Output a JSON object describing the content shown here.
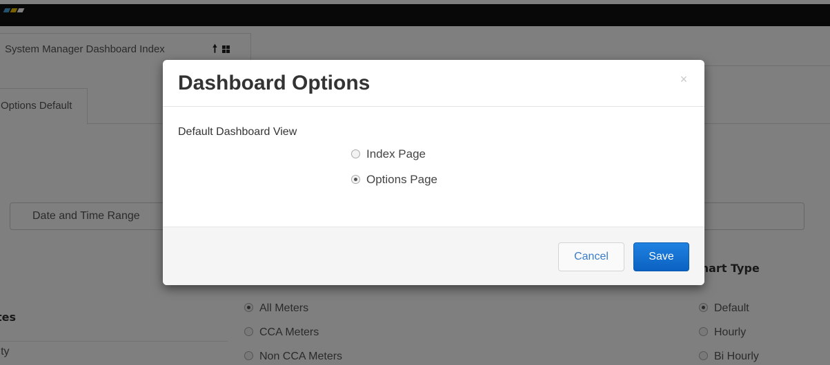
{
  "background": {
    "breadcrumb": {
      "item_label": "System Manager Dashboard Index",
      "icons": [
        "up-arrow-icon",
        "grid-icon"
      ]
    },
    "tab": {
      "label": "Options Default"
    },
    "date_input": {
      "placeholder": "Date and Time Range"
    },
    "chart_type": {
      "heading": "Chart Type",
      "options": [
        {
          "label": "Default",
          "checked": true
        },
        {
          "label": "Hourly",
          "checked": false
        },
        {
          "label": "Bi Hourly",
          "checked": false
        }
      ]
    },
    "meters": {
      "options": [
        {
          "label": "All Meters",
          "checked": true
        },
        {
          "label": "CCA Meters",
          "checked": false
        },
        {
          "label": "Non CCA Meters",
          "checked": false
        }
      ]
    },
    "sidebar": {
      "items": [
        {
          "label": "Sites"
        },
        {
          "label": "City"
        }
      ]
    }
  },
  "modal": {
    "title": "Dashboard Options",
    "close_symbol": "×",
    "field_label": "Default Dashboard View",
    "options": [
      {
        "label": "Index Page",
        "checked": false
      },
      {
        "label": "Options Page",
        "checked": true
      }
    ],
    "cancel_label": "Cancel",
    "save_label": "Save"
  },
  "colors": {
    "topbar": "#111111",
    "primary_button": "#0b61c2",
    "link_button_text": "#3a7cc7",
    "backdrop": "rgba(0,0,0,0.5)"
  }
}
